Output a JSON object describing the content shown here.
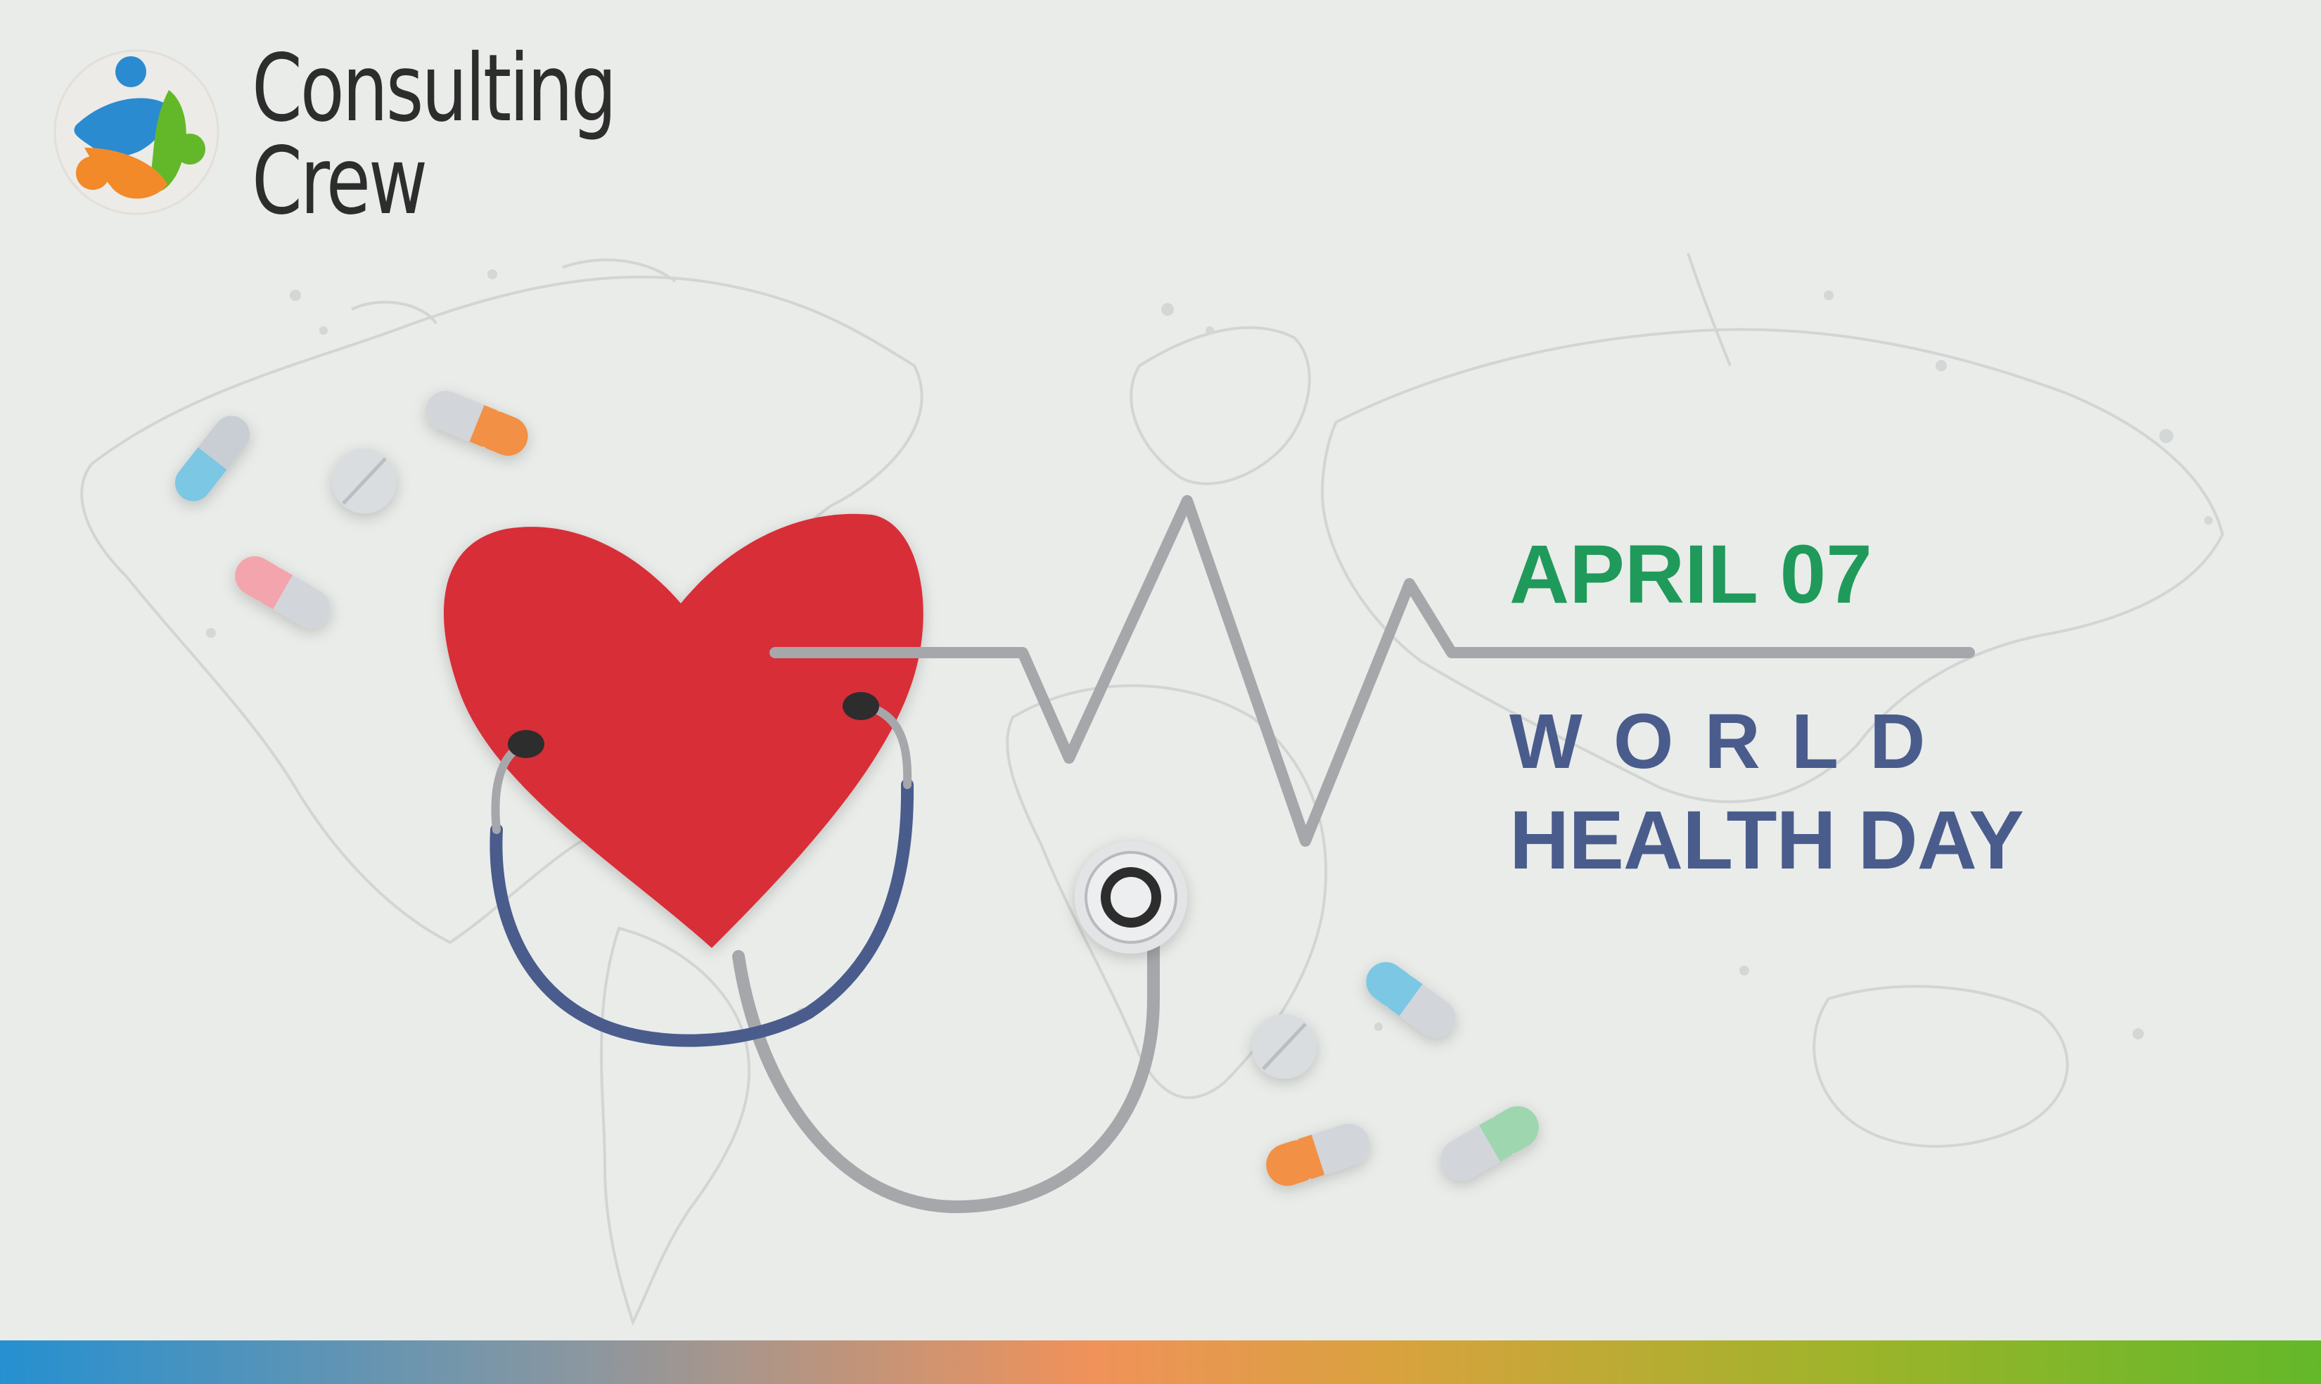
{
  "brand": {
    "name_line1": "Consulting",
    "name_line2": "Crew",
    "logo_icon": "consulting-crew-people-icon"
  },
  "event": {
    "date": "APRIL 07",
    "title_line1": "WORLD",
    "title_line2": "HEALTH DAY"
  },
  "colors": {
    "background": "#e9ece9",
    "heart": "#d82f37",
    "date_green": "#1f9a5a",
    "title_blue": "#4a5c8c",
    "stethoscope_blue": "#4a5c8c",
    "tube_gray": "#a3a4a8",
    "bar_start": "#2590d0",
    "bar_mid": "#f0925a",
    "bar_end": "#63b82a"
  },
  "decor": {
    "background_art": "world-map-water-splash",
    "heart_icon": "heart-icon",
    "stethoscope_icon": "stethoscope-icon",
    "heartbeat_icon": "heartbeat-line-icon",
    "pills": [
      "capsule-blue",
      "tablet-white",
      "capsule-orange",
      "capsule-pink",
      "capsule-cyan",
      "tablet-white",
      "capsule-orange",
      "capsule-green"
    ]
  }
}
